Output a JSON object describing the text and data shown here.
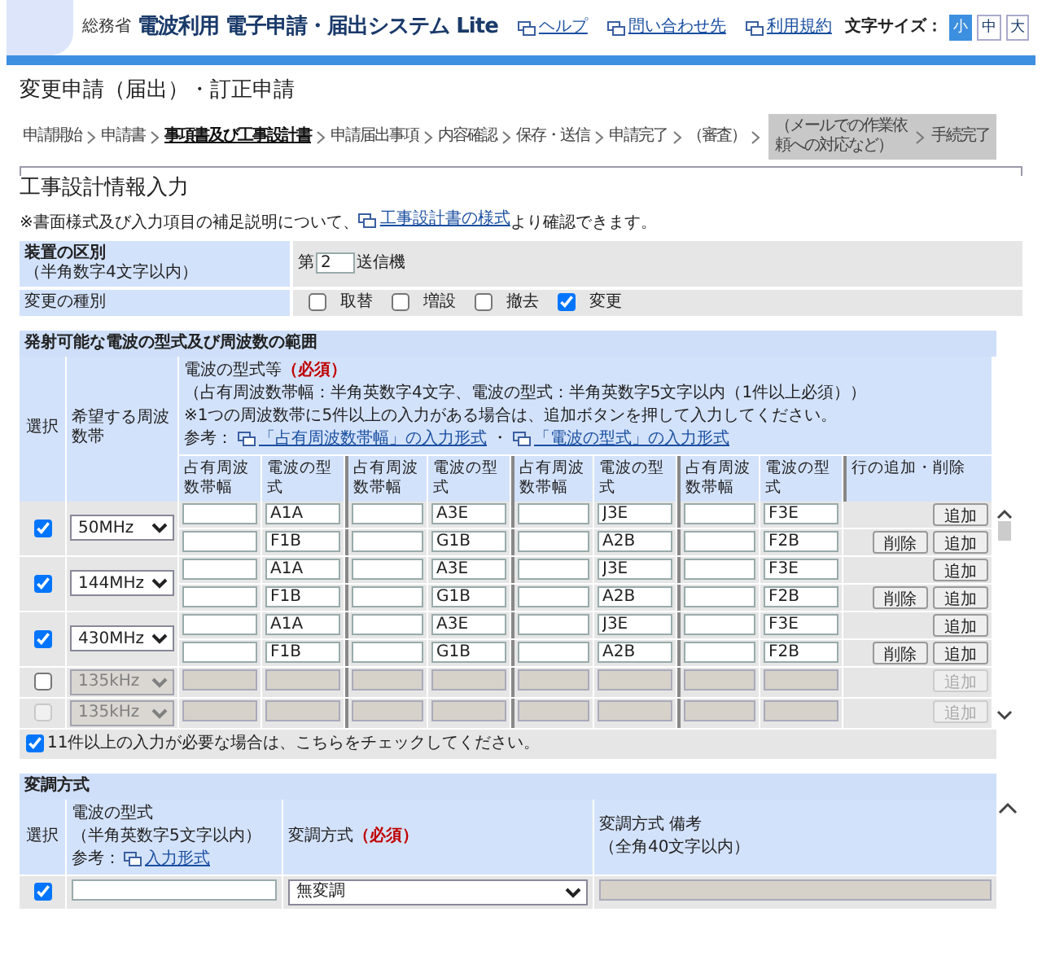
{
  "header": {
    "ministry": "総務省",
    "system_title": "電波利用 電子申請・届出システム Lite",
    "links": [
      "ヘルプ",
      "問い合わせ先",
      "利用規約"
    ],
    "font_size_label": "文字サイズ：",
    "font_sizes": [
      {
        "label": "小",
        "selected": true
      },
      {
        "label": "中",
        "selected": false
      },
      {
        "label": "大",
        "selected": false
      }
    ]
  },
  "page_title": "変更申請（届出）・訂正申請",
  "steps": [
    {
      "label": "申請開始",
      "selected": false,
      "kind": "step"
    },
    {
      "label": "申請書",
      "selected": false,
      "kind": "step"
    },
    {
      "label": "事項書及び工事設計書",
      "selected": true,
      "kind": "step"
    },
    {
      "label": "申請届出事項",
      "selected": false,
      "kind": "step"
    },
    {
      "label": "内容確認",
      "selected": false,
      "kind": "step"
    },
    {
      "label": "保存・送信",
      "selected": false,
      "kind": "step"
    },
    {
      "label": "申請完了",
      "selected": false,
      "kind": "step"
    },
    {
      "label": "（審査）",
      "selected": false,
      "kind": "step"
    },
    {
      "label": "（メールでの作業依頼への対応など）",
      "selected": false,
      "kind": "boxed"
    },
    {
      "label": "手続完了",
      "selected": false,
      "kind": "boxed"
    }
  ],
  "section_title": "工事設計情報入力",
  "note": {
    "before": "※書面様式及び入力項目の補足説明について、",
    "link": "工事設計書の様式",
    "after": "より確認できます。"
  },
  "device": {
    "label": "装置の区別",
    "hint": "（半角数字4文字以内）",
    "prefix": "第",
    "value": "2",
    "suffix": "送信機",
    "change_label": "変更の種別",
    "change_options": [
      {
        "label": "取替",
        "checked": false
      },
      {
        "label": "増設",
        "checked": false
      },
      {
        "label": "撤去",
        "checked": false
      },
      {
        "label": "変更",
        "checked": true
      }
    ]
  },
  "emission": {
    "title": "発射可能な電波の型式及び周波数の範囲",
    "col_select": "選択",
    "col_band": "希望する周波数帯",
    "info_heading": "電波の型式等**（必須）**",
    "info_lines": [
      "（占有周波数帯幅：半角英数字4文字、電波の型式：半角英数字5文字以内（1件以上必須））",
      "※1つの周波数帯に5件以上の入力がある場合は、追加ボタンを押して入力してください。"
    ],
    "ref_label": "参考：",
    "ref_links": [
      "「占有周波数帯幅」の入力形式",
      "「電波の型式」の入力形式"
    ],
    "ref_separator": "・",
    "subcolumns": [
      "占有周波数帯幅",
      "電波の型式",
      "占有周波数帯幅",
      "電波の型式",
      "占有周波数帯幅",
      "電波の型式",
      "占有周波数帯幅",
      "電波の型式",
      "行の追加・削除"
    ],
    "rows": [
      {
        "checked": true,
        "locked": false,
        "band": "50MHz",
        "lines": [
          {
            "types": [
              "A1A",
              "A3E",
              "J3E",
              "F3E"
            ],
            "add": "追加"
          },
          {
            "types": [
              "F1B",
              "G1B",
              "A2B",
              "F2B"
            ],
            "delete": "削除",
            "add": "追加"
          }
        ]
      },
      {
        "checked": true,
        "locked": false,
        "band": "144MHz",
        "lines": [
          {
            "types": [
              "A1A",
              "A3E",
              "J3E",
              "F3E"
            ],
            "add": "追加"
          },
          {
            "types": [
              "F1B",
              "G1B",
              "A2B",
              "F2B"
            ],
            "delete": "削除",
            "add": "追加"
          }
        ]
      },
      {
        "checked": true,
        "locked": false,
        "band": "430MHz",
        "lines": [
          {
            "types": [
              "A1A",
              "A3E",
              "J3E",
              "F3E"
            ],
            "add": "追加"
          },
          {
            "types": [
              "F1B",
              "G1B",
              "A2B",
              "F2B"
            ],
            "delete": "削除",
            "add": "追加"
          }
        ]
      },
      {
        "checked": false,
        "locked": false,
        "band": "135kHz",
        "lines": [
          {
            "add": "追加"
          }
        ]
      },
      {
        "checked": false,
        "locked": true,
        "band": "135kHz",
        "lines": [
          {
            "add": "追加"
          }
        ]
      }
    ],
    "extra": {
      "checked": true,
      "label": "11件以上の入力が必要な場合は、こちらをチェックしてください。"
    }
  },
  "modulation": {
    "title": "変調方式",
    "col_select": "選択",
    "type_heading": "電波の型式",
    "type_hint": "（半角英数字5文字以内）",
    "ref_label": "参考：",
    "ref_link": "入力形式",
    "method_heading": "変調方式**（必須）**",
    "remarks_heading": "変調方式 備考",
    "remarks_hint": "（全角40文字以内）",
    "rows": [
      {
        "checked": true,
        "method": "無変調"
      }
    ]
  }
}
